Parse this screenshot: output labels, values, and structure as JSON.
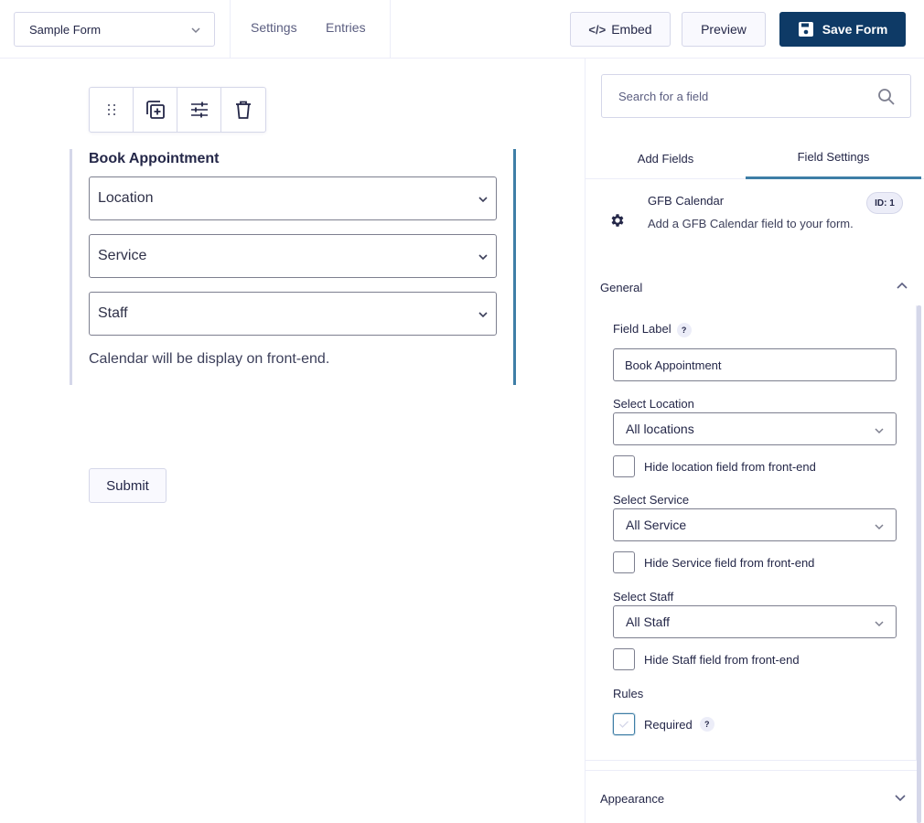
{
  "header": {
    "form_selector": {
      "value": "Sample Form"
    },
    "nav": [
      {
        "label": "Settings"
      },
      {
        "label": "Entries"
      }
    ],
    "embed_label": "Embed",
    "embed_icon_text": "</>",
    "preview_label": "Preview",
    "save_label": "Save Form",
    "save_color": "#0e3a66"
  },
  "canvas": {
    "toolbar": [
      {
        "name": "drag-handle",
        "icon": "drag-dots-icon"
      },
      {
        "name": "duplicate",
        "icon": "duplicate-icon"
      },
      {
        "name": "settings",
        "icon": "sliders-icon"
      },
      {
        "name": "delete",
        "icon": "trash-icon"
      }
    ],
    "field": {
      "title": "Book Appointment",
      "selects": [
        {
          "value": "Location"
        },
        {
          "value": "Service"
        },
        {
          "value": "Staff"
        }
      ],
      "description": "Calendar will be display on front-end.",
      "accent_color": "#3e7ea6"
    },
    "submit_label": "Submit"
  },
  "panel": {
    "search_placeholder": "Search for a field",
    "tabs": [
      {
        "label": "Add Fields",
        "active": false
      },
      {
        "label": "Field Settings",
        "active": true
      }
    ],
    "field_info": {
      "name": "GFB Calendar",
      "description": "Add a GFB Calendar field to your form.",
      "id_badge": "ID: 1"
    },
    "general": {
      "title": "General",
      "field_label": {
        "label": "Field Label",
        "help": "?",
        "value": "Book Appointment"
      },
      "location": {
        "label": "Select Location",
        "value": "All locations",
        "checkbox": "Hide location field from front-end",
        "checked": false
      },
      "service": {
        "label": "Select Service",
        "value": "All Service",
        "checkbox": "Hide Service field from front-end",
        "checked": false
      },
      "staff": {
        "label": "Select Staff",
        "value": "All Staff",
        "checkbox": "Hide Staff field from front-end",
        "checked": false
      },
      "rules": {
        "label": "Rules",
        "required_label": "Required",
        "help": "?",
        "required_checked": false
      }
    },
    "appearance": {
      "title": "Appearance"
    }
  }
}
